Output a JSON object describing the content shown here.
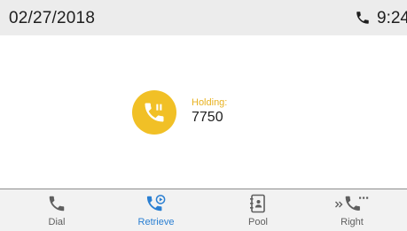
{
  "status_bar": {
    "date": "02/27/2018",
    "time": "9:24",
    "phone_icon": "phone-icon"
  },
  "call": {
    "state_label": "Holding:",
    "number": "7750",
    "icon": "phone-hold-icon",
    "accent_color": "#f1c026"
  },
  "softkeys": [
    {
      "label": "Dial",
      "icon": "phone-icon",
      "active": false
    },
    {
      "label": "Retrieve",
      "icon": "phone-retrieve-icon",
      "active": true
    },
    {
      "label": "Pool",
      "icon": "contacts-book-icon",
      "active": false
    },
    {
      "label": "Right",
      "icon": "more-chevron-phone-icon",
      "active": false
    }
  ],
  "colors": {
    "status_bar_bg": "#ececec",
    "active_softkey": "#2a7fd2",
    "icon_gray": "#5f5f5f"
  }
}
